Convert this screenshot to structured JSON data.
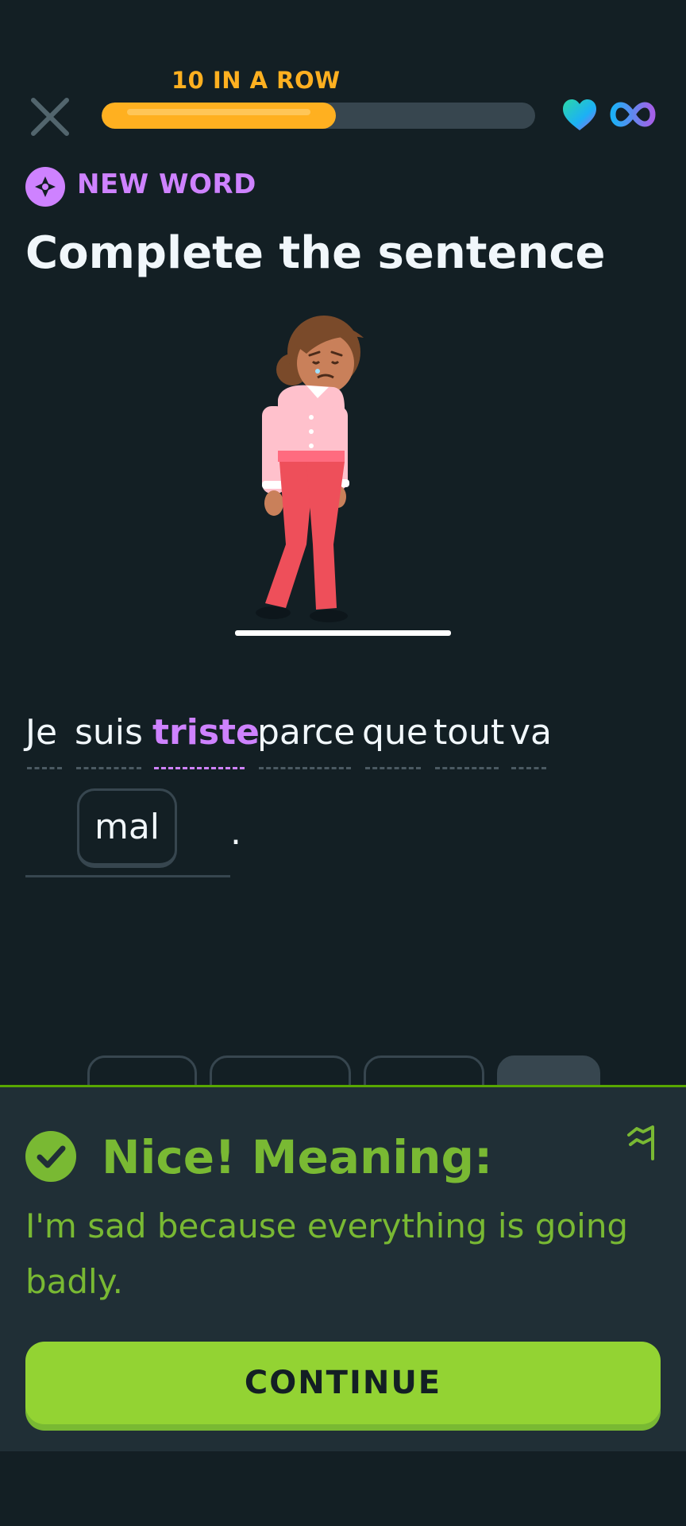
{
  "top_bar": {
    "streak_label": "10 IN A ROW",
    "progress": 0.54,
    "close_icon": "close-icon",
    "hearts_icon": "heart-icon",
    "hearts_value_icon": "infinity-icon"
  },
  "header": {
    "badge_label": "NEW WORD",
    "badge_icon": "new-word-sparkle-icon",
    "title": "Complete the sentence"
  },
  "exercise": {
    "illustration": "sad-woman-illustration",
    "sentence_words": [
      "Je",
      "suis",
      "triste",
      "parce",
      "que",
      "tout",
      "va"
    ],
    "highlighted_word": "triste",
    "answer": "mal",
    "trailing_punctuation": "."
  },
  "feedback": {
    "title": "Nice! Meaning:",
    "text": "I'm sad because everything is going badly.",
    "continue_label": "CONTINUE",
    "check_icon": "check-circle-icon",
    "report_icon": "flag-icon"
  },
  "colors": {
    "background": "#131f24",
    "streak": "#ffb020",
    "new_word": "#ce82ff",
    "success": "#79b933",
    "button": "#93d333"
  }
}
